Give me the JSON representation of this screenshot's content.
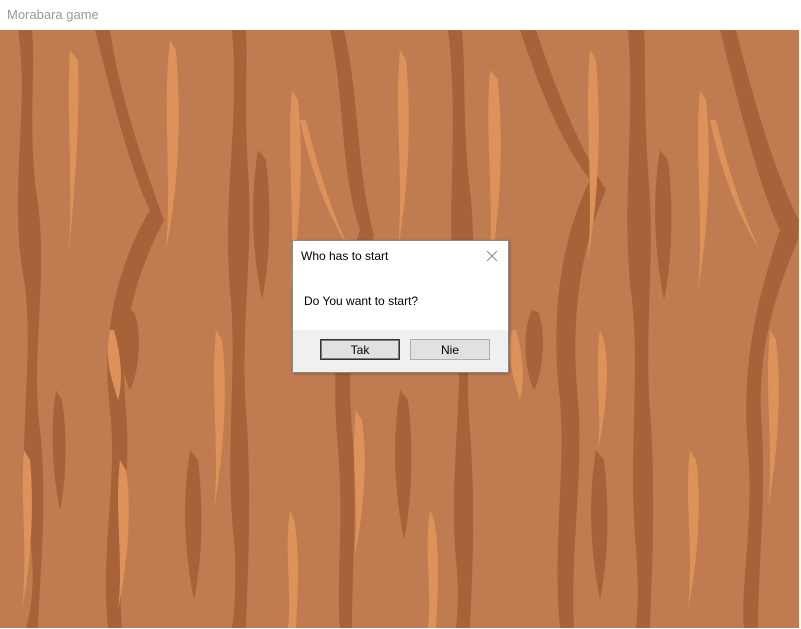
{
  "window": {
    "title": "Morabara game"
  },
  "colors": {
    "wood_base": "#c07c50",
    "wood_dark": "#a8623a",
    "wood_light": "#dc9258"
  },
  "dialog": {
    "title": "Who has to start",
    "close_icon": "close-icon",
    "message": "Do You want to start?",
    "yes_label": "Tak",
    "no_label": "Nie"
  }
}
